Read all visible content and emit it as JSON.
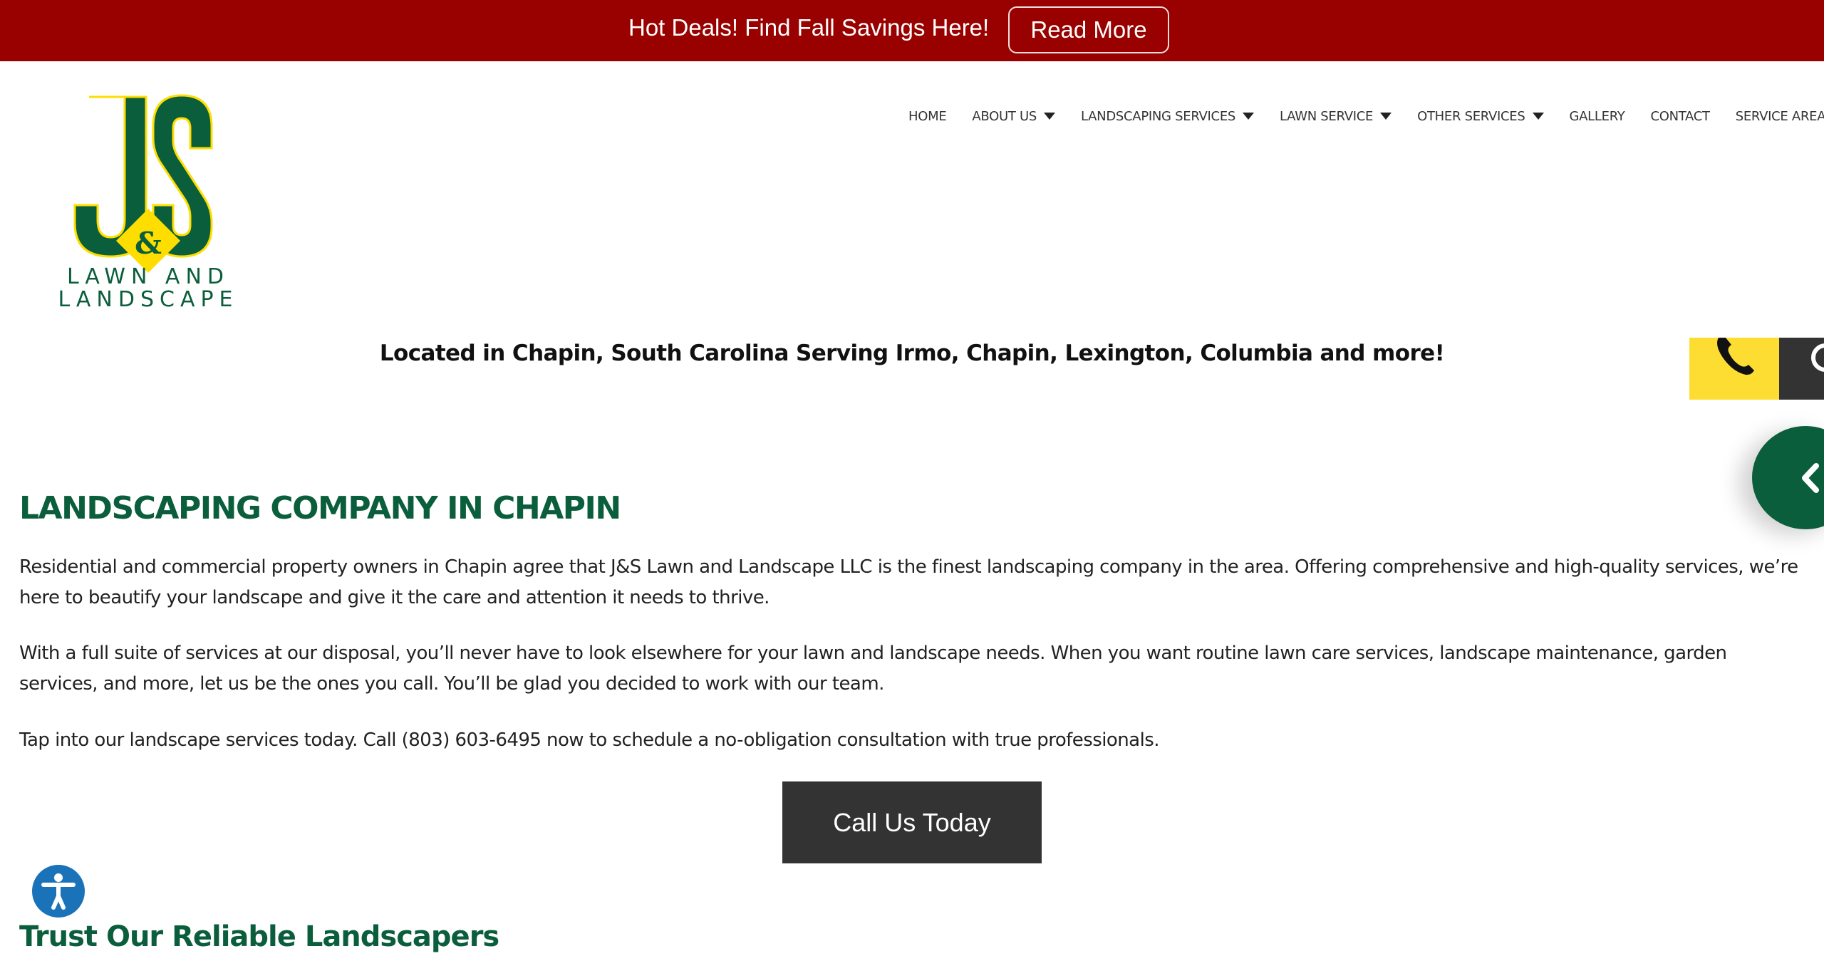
{
  "promo": {
    "text": "Hot Deals! Find Fall Savings Here!",
    "button_label": "Read More",
    "background": "#990000"
  },
  "logo": {
    "monogram": "JS",
    "ampersand": "&",
    "line1": "LAWN AND",
    "line2": "LANDSCAPE",
    "colors": {
      "green": "#0b5e3c",
      "yellow": "#fedd00"
    }
  },
  "nav": {
    "items": [
      {
        "label": "HOME",
        "has_dropdown": false
      },
      {
        "label": "ABOUT US",
        "has_dropdown": true
      },
      {
        "label": "LANDSCAPING SERVICES",
        "has_dropdown": true
      },
      {
        "label": "LAWN SERVICE",
        "has_dropdown": true
      },
      {
        "label": "OTHER SERVICES",
        "has_dropdown": true
      },
      {
        "label": "GALLERY",
        "has_dropdown": false
      },
      {
        "label": "CONTACT",
        "has_dropdown": false
      },
      {
        "label": "SERVICE AREAS",
        "has_dropdown": false
      }
    ]
  },
  "location_text": "Located in Chapin, South Carolina Serving Irmo, Chapin, Lexington, Columbia and more!",
  "widgets": {
    "call_icon": "phone-icon",
    "chat_icon": "chat-icon",
    "toggle_icon": "chevron-left-icon",
    "accessibility_icon": "accessibility-icon"
  },
  "main": {
    "heading": "LANDSCAPING COMPANY IN CHAPIN",
    "paragraphs": [
      "Residential and commercial property owners in Chapin agree that J&S Lawn and Landscape LLC is the finest landscaping company in the area. Offering comprehensive and high-quality services, we’re here to beautify your landscape and give it the care and attention it needs to thrive.",
      "With a full suite of services at our disposal, you’ll never have to look elsewhere for your lawn and landscape needs. When you want routine lawn care services, landscape maintenance, garden services, and more, let us be the ones you call. You’ll be glad you decided to work with our team.",
      "Tap into our landscape services today. Call (803) 603-6495 now to schedule a no-obligation consultation with true professionals."
    ],
    "cta_label": "Call Us Today",
    "subheading": "Trust Our Reliable Landscapers"
  }
}
